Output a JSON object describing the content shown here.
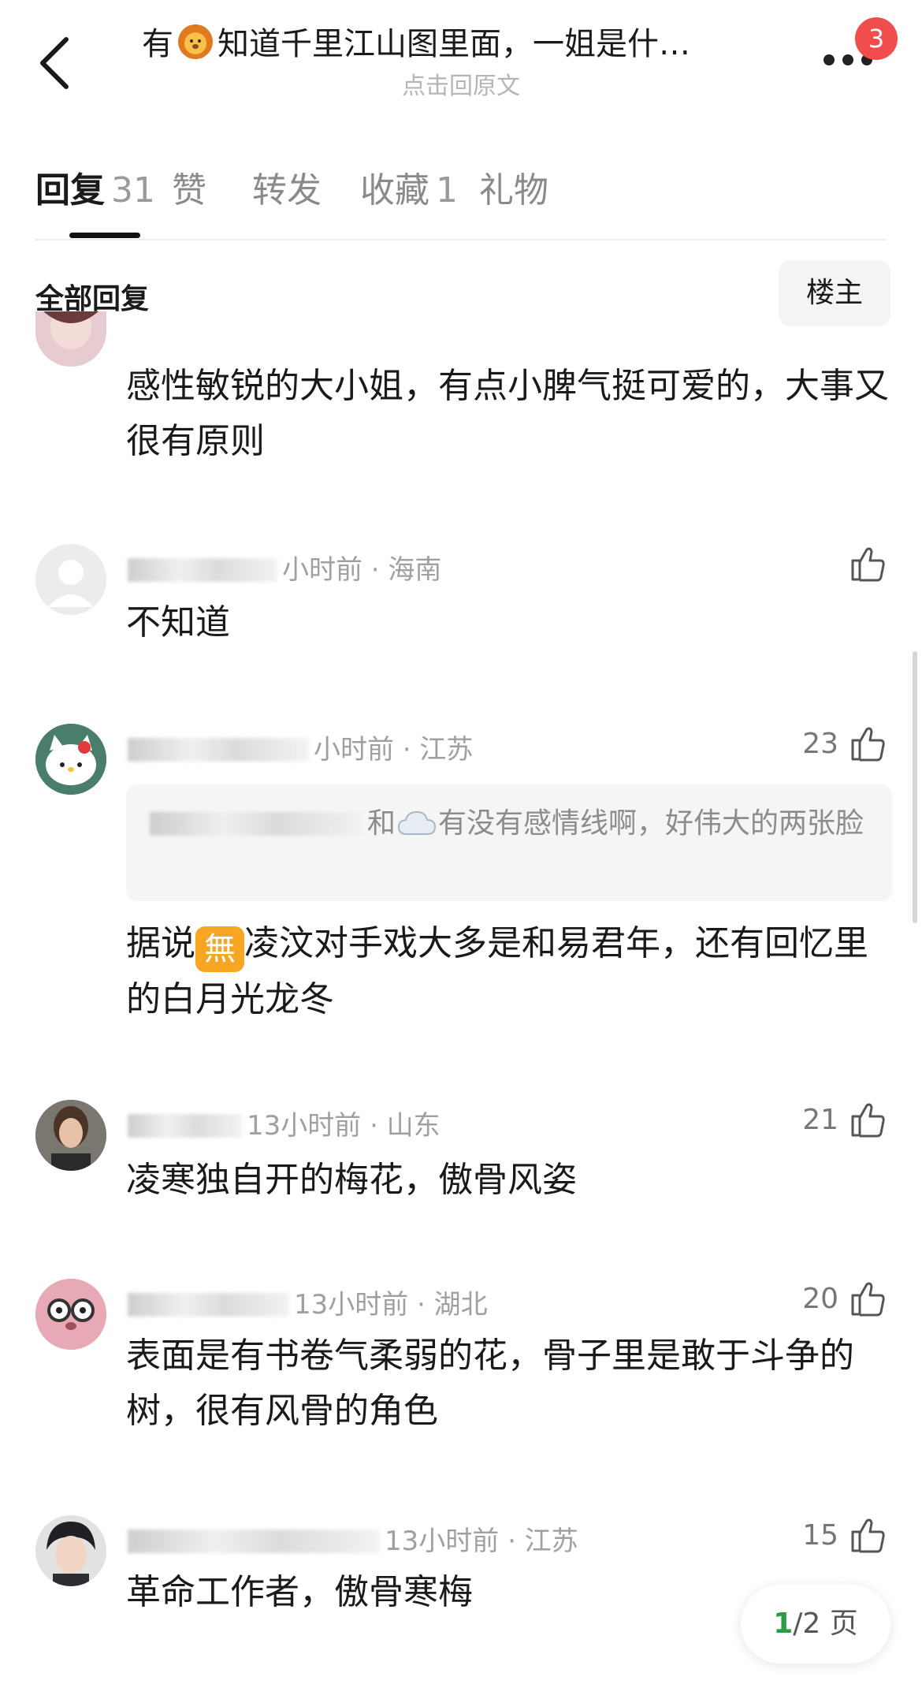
{
  "header": {
    "title_before": "有",
    "title_after": "知道千里江山图里面，一姐是什…",
    "subtitle": "点击回原文",
    "badge_count": "3"
  },
  "tabs": [
    {
      "label": "回复",
      "count": "31",
      "active": true
    },
    {
      "label": "赞",
      "count": "",
      "active": false
    },
    {
      "label": "转发",
      "count": "",
      "active": false
    },
    {
      "label": "收藏",
      "count": "1",
      "active": false
    },
    {
      "label": "礼物",
      "count": "",
      "active": false
    }
  ],
  "section": {
    "title": "全部回复",
    "filter_label": "楼主"
  },
  "comments": [
    {
      "text": "感性敏锐的大小姐，有点小脾气挺可爱的，大事又很有原则"
    },
    {
      "meta": "小时前 · 海南",
      "likes": "",
      "text": "不知道"
    },
    {
      "meta": "小时前 · 江苏",
      "likes": "23",
      "quote_after_blur": "和",
      "quote_text": "有没有感情线啊，好伟大的两张脸",
      "text_before": "据说",
      "emoji_char": "無",
      "text_after": "凌汶对手戏大多是和易君年，还有回忆里的白月光龙冬"
    },
    {
      "meta": "13小时前 · 山东",
      "likes": "21",
      "text": "凌寒独自开的梅花，傲骨风姿"
    },
    {
      "meta": "13小时前 · 湖北",
      "likes": "20",
      "text": "表面是有书卷气柔弱的花，骨子里是敢于斗争的树，很有风骨的角色"
    },
    {
      "meta": "13小时前 · 江苏",
      "likes": "15",
      "text": "革命工作者，傲骨寒梅"
    }
  ],
  "pager": {
    "current": "1",
    "total": "/2 页"
  },
  "colors": {
    "badge": "#f24d4d",
    "pager_current": "#2c9b45",
    "emoji_bg": "#f6a623"
  }
}
